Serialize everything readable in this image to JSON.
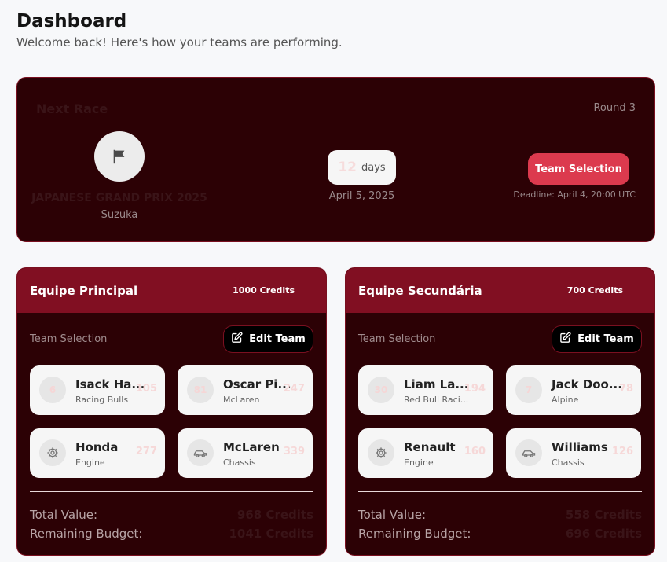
{
  "page": {
    "title": "Dashboard",
    "subtitle": "Welcome back! Here's how your teams are performing."
  },
  "next_race": {
    "heading": "Next Race",
    "round": "Round 3",
    "name": "JAPANESE GRAND PRIX 2025",
    "circuit": "Suzuka",
    "days_count": "12",
    "days_label": "days",
    "date": "April 5, 2025",
    "button_label": "Team Selection",
    "deadline": "Deadline: April 4, 20:00 UTC",
    "icon": "flag-icon"
  },
  "teams": [
    {
      "name": "Equipe Principal",
      "credits": "1000 Credits",
      "subheading": "Team Selection",
      "edit_label": "Edit Team",
      "slots": [
        {
          "badge": "6",
          "name": "Isack Ha...",
          "team": "Racing Bulls",
          "value": "105"
        },
        {
          "badge": "81",
          "name": "Oscar Pi...",
          "team": "McLaren",
          "value": "247"
        },
        {
          "icon": "gear-icon",
          "name": "Honda",
          "team": "Engine",
          "value": "277"
        },
        {
          "icon": "car-icon",
          "name": "McLaren",
          "team": "Chassis",
          "value": "339"
        }
      ],
      "total_label": "Total Value:",
      "total_value": "968 Credits",
      "budget_label": "Remaining Budget:",
      "budget_value": "1041 Credits"
    },
    {
      "name": "Equipe Secundária",
      "credits": "700 Credits",
      "subheading": "Team Selection",
      "edit_label": "Edit Team",
      "slots": [
        {
          "badge": "30",
          "name": "Liam La...",
          "team": "Red Bull Raci...",
          "value": "194"
        },
        {
          "badge": "7",
          "name": "Jack Doo...",
          "team": "Alpine",
          "value": "78"
        },
        {
          "icon": "gear-icon",
          "name": "Renault",
          "team": "Engine",
          "value": "160"
        },
        {
          "icon": "car-icon",
          "name": "Williams",
          "team": "Chassis",
          "value": "126"
        }
      ],
      "total_label": "Total Value:",
      "total_value": "558 Credits",
      "budget_label": "Remaining Budget:",
      "budget_value": "696 Credits"
    }
  ],
  "colors": {
    "card_bg": "#2c0105",
    "header_bg": "#810f22",
    "accent_button": "#dc3a4e"
  }
}
